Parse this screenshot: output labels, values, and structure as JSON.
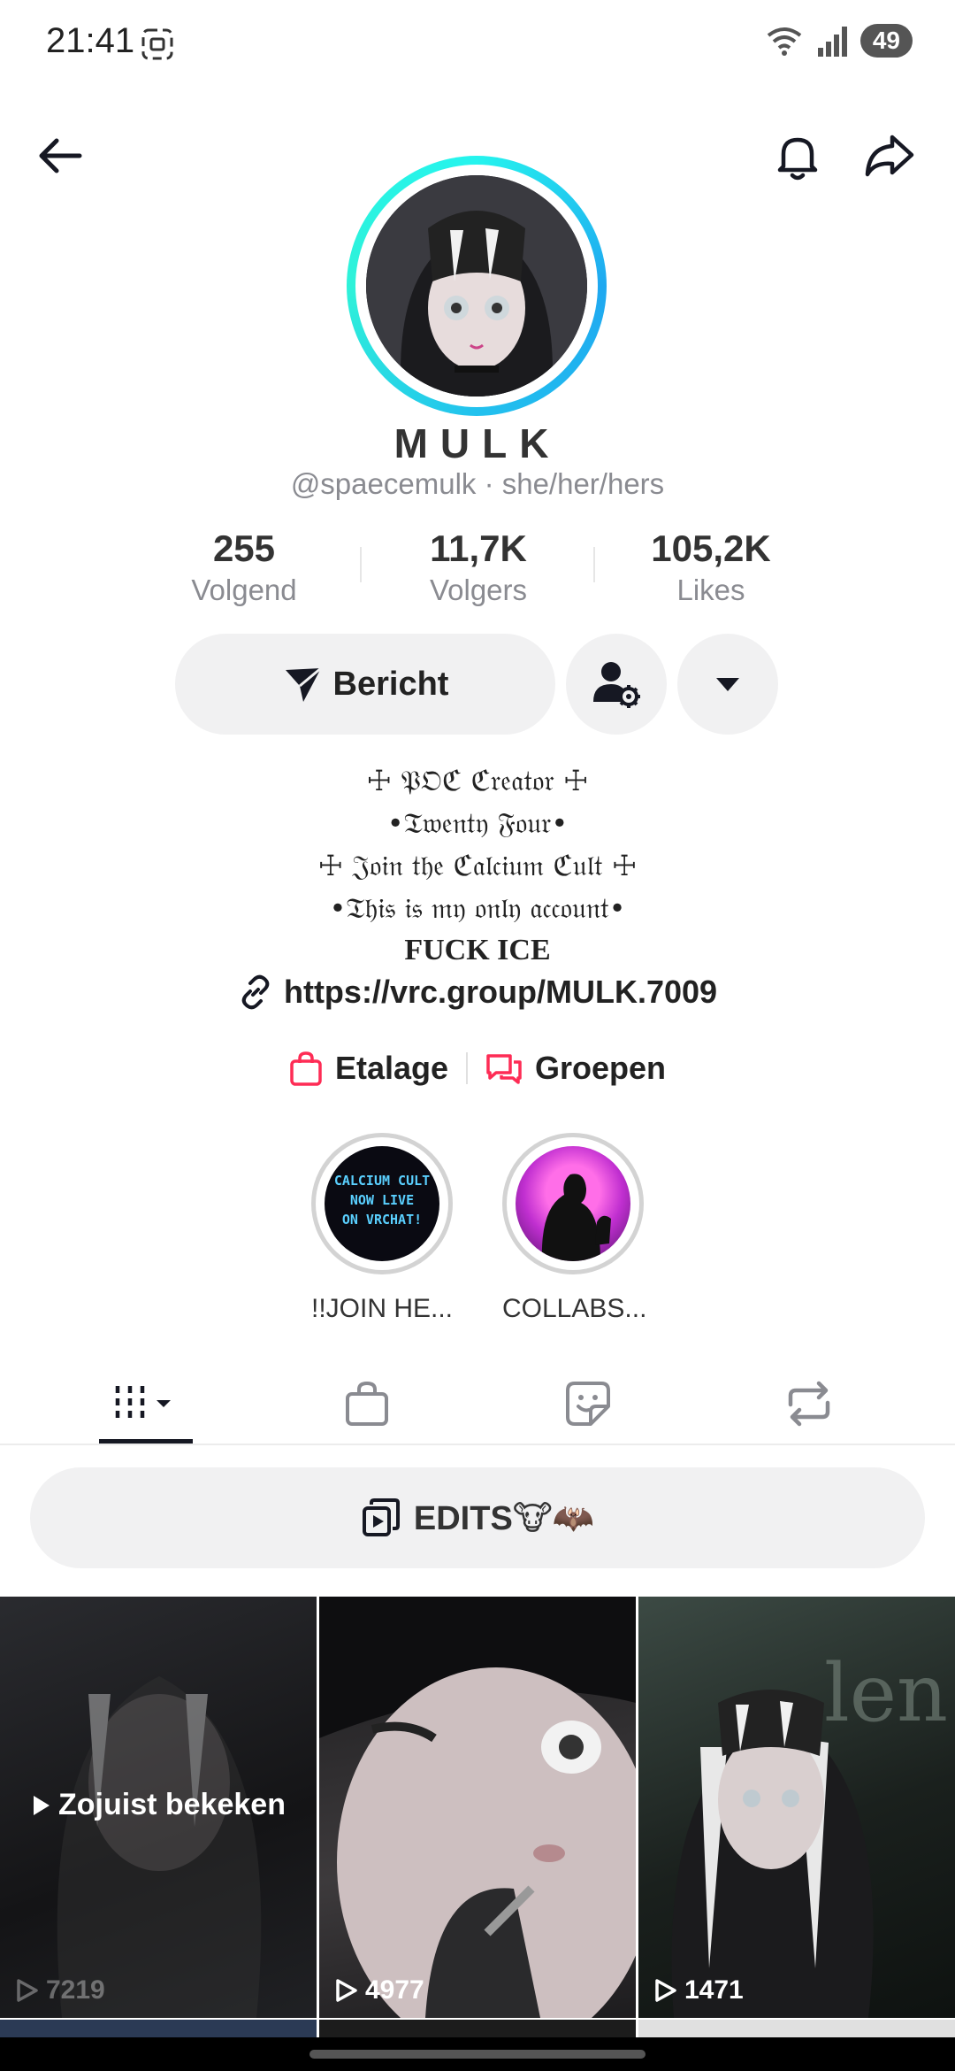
{
  "status_bar": {
    "time": "21:41",
    "battery": "49"
  },
  "profile": {
    "display_name": "MULK",
    "handle_line": "@spaecemulk · she/her/hers",
    "stats": [
      {
        "value": "255",
        "label": "Volgend"
      },
      {
        "value": "11,7K",
        "label": "Volgers"
      },
      {
        "value": "105,2K",
        "label": "Likes"
      }
    ],
    "message_button": "Bericht",
    "bio": [
      "☩ 𝔓𝔒ℭ ℭ𝔯𝔢𝔞𝔱𝔬𝔯 ☩",
      "•𝔗𝔴𝔢𝔫𝔱𝔶 𝔉𝔬𝔲𝔯•",
      "☩ 𝔍𝔬𝔦𝔫 𝔱𝔥𝔢 ℭ𝔞𝔩𝔠𝔦𝔲𝔪 ℭ𝔲𝔩𝔱 ☩",
      "•𝔗𝔥𝔦𝔰 𝔦𝔰 𝔪𝔶 𝔬𝔫𝔩𝔶 𝔞𝔠𝔠𝔬𝔲𝔫𝔱•",
      "FUCK ICE"
    ],
    "link": "https://vrc.group/MULK.7009",
    "shop_label": "Etalage",
    "groups_label": "Groepen"
  },
  "highlights": [
    {
      "caption": "!!JOIN HE...",
      "thumb_text": [
        "CALCIUM CULT",
        "NOW LIVE",
        "ON VRCHAT!"
      ]
    },
    {
      "caption": "COLLABS..."
    }
  ],
  "playlist": {
    "label": "EDITS🐮🦇"
  },
  "videos": [
    {
      "views": "7219",
      "overlay": "Zojuist bekeken"
    },
    {
      "views": "4977"
    },
    {
      "views": "1471"
    }
  ],
  "colors": {
    "accent_red": "#fe2c55",
    "ring_cyan": "#25f4ee",
    "surface": "#f1f1f2"
  }
}
